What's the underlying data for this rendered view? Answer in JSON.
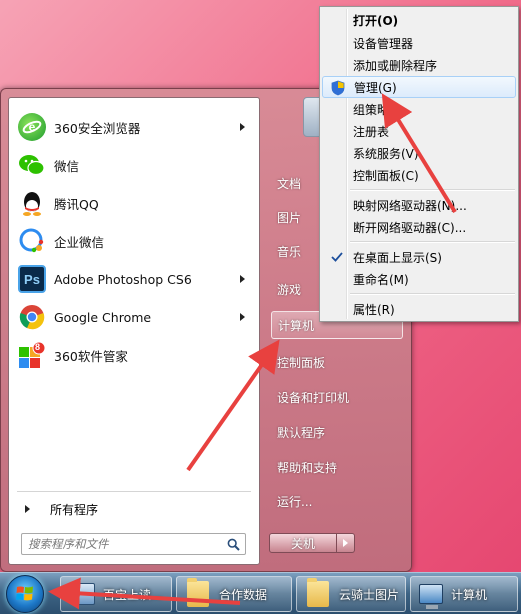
{
  "start_menu": {
    "programs": [
      {
        "label": "360安全浏览器",
        "icon": "360-browser-icon",
        "has_submenu": true
      },
      {
        "label": "微信",
        "icon": "wechat-icon",
        "has_submenu": false
      },
      {
        "label": "腾讯QQ",
        "icon": "qq-icon",
        "has_submenu": false
      },
      {
        "label": "企业微信",
        "icon": "wecom-icon",
        "has_submenu": false
      },
      {
        "label": "Adobe Photoshop CS6",
        "icon": "photoshop-icon",
        "has_submenu": true,
        "icon_text": "Ps"
      },
      {
        "label": "Google Chrome",
        "icon": "chrome-icon",
        "has_submenu": true
      },
      {
        "label": "360软件管家",
        "icon": "360-software-manager-icon",
        "has_submenu": false,
        "badge": "8"
      }
    ],
    "all_programs": "所有程序",
    "search_placeholder": "搜索程序和文件",
    "right_items": [
      {
        "label": "文档"
      },
      {
        "label": "图片"
      },
      {
        "label": "音乐"
      },
      {
        "label": "游戏"
      },
      {
        "label": "计算机",
        "highlighted": true
      },
      {
        "label": "控制面板"
      },
      {
        "label": "设备和打印机"
      },
      {
        "label": "默认程序"
      },
      {
        "label": "帮助和支持"
      },
      {
        "label": "运行..."
      }
    ],
    "shutdown_label": "关机"
  },
  "context_menu": {
    "items": [
      {
        "label": "打开(O)",
        "bold": true
      },
      {
        "label": "设备管理器"
      },
      {
        "label": "添加或删除程序"
      },
      {
        "label": "管理(G)",
        "highlighted": true,
        "icon": "uac-shield-icon"
      },
      {
        "label": "组策略"
      },
      {
        "label": "注册表"
      },
      {
        "label": "系统服务(V)"
      },
      {
        "label": "控制面板(C)"
      },
      {
        "label": "映射网络驱动器(N)..."
      },
      {
        "label": "断开网络驱动器(C)..."
      },
      {
        "label": "在桌面上显示(S)",
        "checked": true
      },
      {
        "label": "重命名(M)"
      },
      {
        "label": "属性(R)"
      }
    ]
  },
  "taskbar": {
    "buttons": [
      {
        "label": "百宝上读...",
        "icon": "window-icon"
      },
      {
        "label": "合作数据",
        "icon": "folder-icon"
      },
      {
        "label": "云骑士图片",
        "icon": "folder-icon"
      },
      {
        "label": "计算机",
        "icon": "computer-icon"
      }
    ]
  },
  "colors": {
    "annotation_arrow": "#e8413f",
    "highlight_blue": "#dcebfc",
    "desktop": "#f06b8a"
  }
}
